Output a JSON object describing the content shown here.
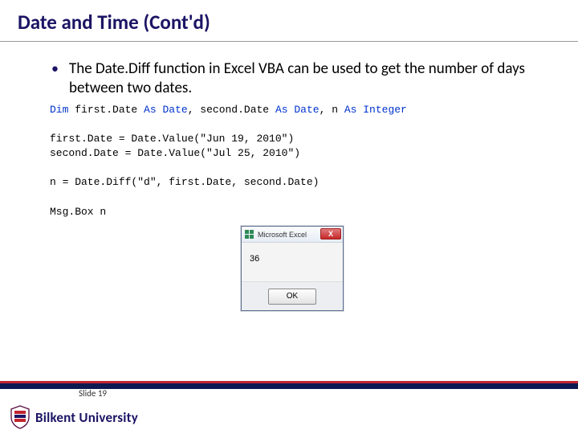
{
  "title": "Date and Time (Cont'd)",
  "bullet1": "The Date.Diff function in Excel VBA can be used to get the number of days between two dates.",
  "code": {
    "dim": "Dim",
    "var1": "first.Date",
    "as": "As",
    "date_t": "Date",
    "var2": "second.Date",
    "var3": "n",
    "integer_t": "Integer",
    "assign1": "first.Date = Date.Value(\"Jun 19, 2010\")",
    "assign2": "second.Date = Date.Value(\"Jul 25, 2010\")",
    "assign3": "n = Date.Diff(\"d\", first.Date, second.Date)",
    "msgbox": "Msg.Box n"
  },
  "dialog": {
    "title": "Microsoft Excel",
    "body": "36",
    "ok": "OK",
    "close": "X"
  },
  "slide_label": "Slide 19",
  "university": "Bilkent University"
}
